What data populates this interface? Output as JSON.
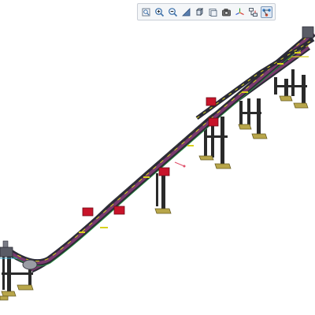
{
  "viewer": {
    "background": "#ffffff",
    "toolbar": {
      "buttons": [
        {
          "name": "zoom-fit-icon",
          "active": false
        },
        {
          "name": "zoom-in-icon",
          "active": false
        },
        {
          "name": "zoom-out-icon",
          "active": false
        },
        {
          "name": "zoom-window-icon",
          "active": false
        },
        {
          "name": "view-cube-icon",
          "active": false
        },
        {
          "name": "render-mode-icon",
          "active": false
        },
        {
          "name": "camera-icon",
          "active": false
        },
        {
          "name": "axes-icon",
          "active": false
        },
        {
          "name": "hierarchy-icon",
          "active": false
        },
        {
          "name": "flow-settings-icon",
          "active": true
        }
      ]
    },
    "model": {
      "description_colors": {
        "conveyor_frame": "#2b2b36",
        "conveyor_rail_yellow": "#d9d21e",
        "conveyor_belt_purple": "#7a3a6e",
        "guide_green": "#2fa04a",
        "drive_unit_red": "#c8142a",
        "support_leg": "#2a2a2a",
        "foot_plate": "#b8a64a"
      }
    }
  }
}
